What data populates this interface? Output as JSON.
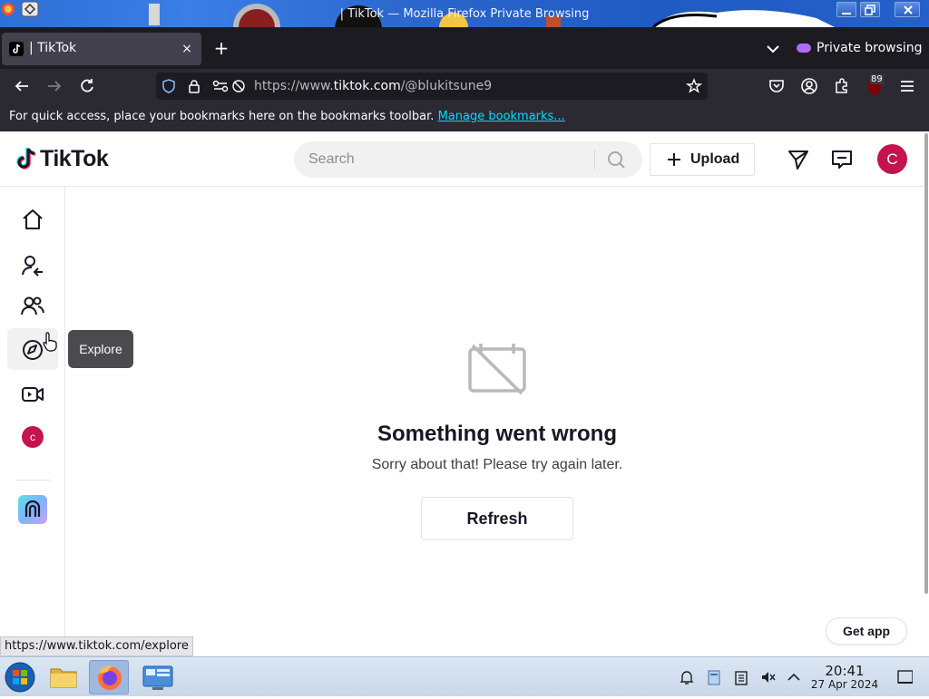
{
  "window": {
    "title": "| TikTok — Mozilla Firefox Private Browsing"
  },
  "browser": {
    "tab_label": "| TikTok",
    "tab_close": "×",
    "new_tab": "+",
    "private_label": "Private browsing",
    "url_prefix": "https://www.",
    "url_host": "tiktok.com",
    "url_path": "/@blukitsune9",
    "extensions_badge": "89",
    "bookmarks_msg": "For quick access, place your bookmarks here on the bookmarks toolbar.",
    "bookmarks_link": "Manage bookmarks...",
    "status_url": "https://www.tiktok.com/explore"
  },
  "tiktok": {
    "logo_text": "TikTok",
    "search_placeholder": "Search",
    "upload_label": "Upload",
    "avatar_initial": "C",
    "sidebar_avatar_initial": "c",
    "tooltip": "Explore",
    "error_title": "Something went wrong",
    "error_sub": "Sorry about that! Please try again later.",
    "refresh_label": "Refresh",
    "get_app_label": "Get app"
  },
  "sidebar_items": [
    {
      "name": "sidebar-item-home",
      "icon": "home-icon"
    },
    {
      "name": "sidebar-item-following",
      "icon": "following-icon"
    },
    {
      "name": "sidebar-item-friends",
      "icon": "friends-icon"
    },
    {
      "name": "sidebar-item-explore",
      "icon": "compass-icon"
    },
    {
      "name": "sidebar-item-live",
      "icon": "live-video-icon"
    }
  ],
  "taskbar": {
    "time": "20:41",
    "date": "27 Apr 2024"
  },
  "colors": {
    "tiktok_red": "#c4134d",
    "firefox_dark": "#1c1b22",
    "private_purple": "#b06bf7",
    "link_cyan": "#00ddff"
  }
}
